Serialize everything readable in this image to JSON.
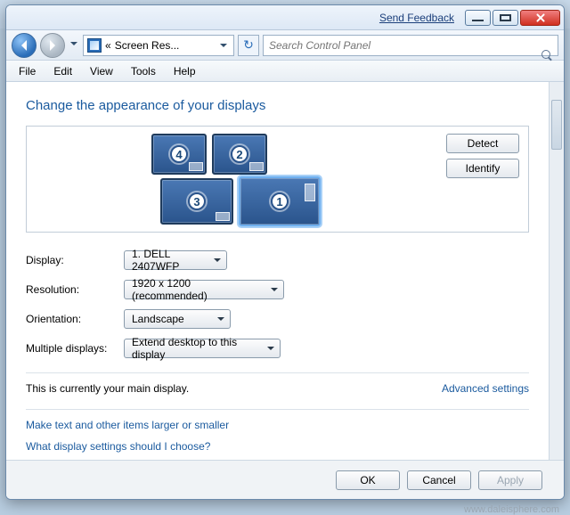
{
  "titlebar": {
    "feedback": "Send Feedback"
  },
  "nav": {
    "address_prefix": "«",
    "address": "Screen Res..."
  },
  "search": {
    "placeholder": "Search Control Panel"
  },
  "menu": {
    "file": "File",
    "edit": "Edit",
    "view": "View",
    "tools": "Tools",
    "help": "Help"
  },
  "heading": "Change the appearance of your displays",
  "buttons": {
    "detect": "Detect",
    "identify": "Identify"
  },
  "monitors": {
    "m1": "1",
    "m2": "2",
    "m3": "3",
    "m4": "4"
  },
  "form": {
    "display_label": "Display:",
    "display_value": "1. DELL 2407WFP",
    "resolution_label": "Resolution:",
    "resolution_value": "1920 x 1200 (recommended)",
    "orientation_label": "Orientation:",
    "orientation_value": "Landscape",
    "multi_label": "Multiple displays:",
    "multi_value": "Extend desktop to this display"
  },
  "status": {
    "main": "This is currently your main display.",
    "advanced": "Advanced settings"
  },
  "links": {
    "larger": "Make text and other items larger or smaller",
    "choose": "What display settings should I choose?"
  },
  "footer": {
    "ok": "OK",
    "cancel": "Cancel",
    "apply": "Apply"
  },
  "watermark": "www.daleisphere.com"
}
